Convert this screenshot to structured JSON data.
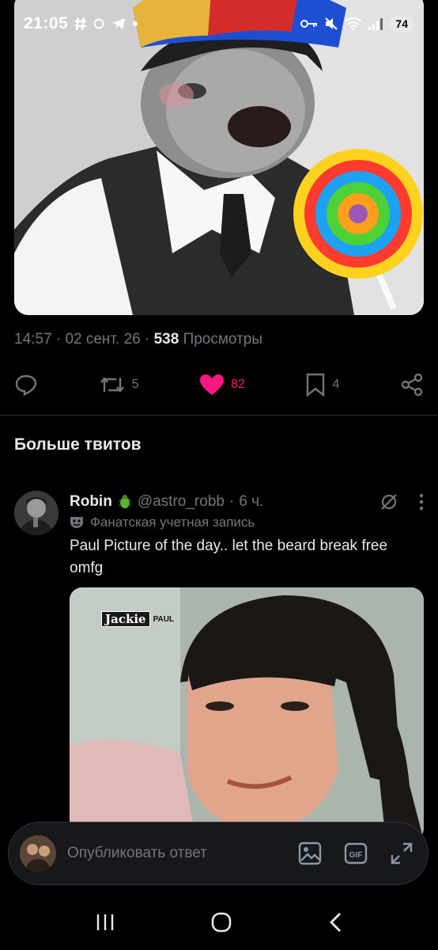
{
  "status_bar": {
    "time": "21:05",
    "battery": "74"
  },
  "top_tweet": {
    "time": "14:57",
    "date": "02 сент. 26",
    "views_count": "538",
    "views_label": "Просмотры",
    "actions": {
      "retweets": "5",
      "likes": "82",
      "bookmarks": "4"
    }
  },
  "section": {
    "title": "Больше твитов"
  },
  "reply_tweet": {
    "author": "Robin",
    "handle": "@astro_robb",
    "time_ago": "6 ч.",
    "badge_label": "Фанатская учетная запись",
    "text": "Paul Picture of the day.. let the beard break free omfg",
    "image_logo_text": "Jackie",
    "image_logo_sub": "PAUL"
  },
  "composer": {
    "placeholder": "Опубликовать ответ"
  },
  "colors": {
    "background": "#000000",
    "text_primary": "#e7e9ea",
    "text_secondary": "#71767b",
    "like": "#f91880"
  }
}
